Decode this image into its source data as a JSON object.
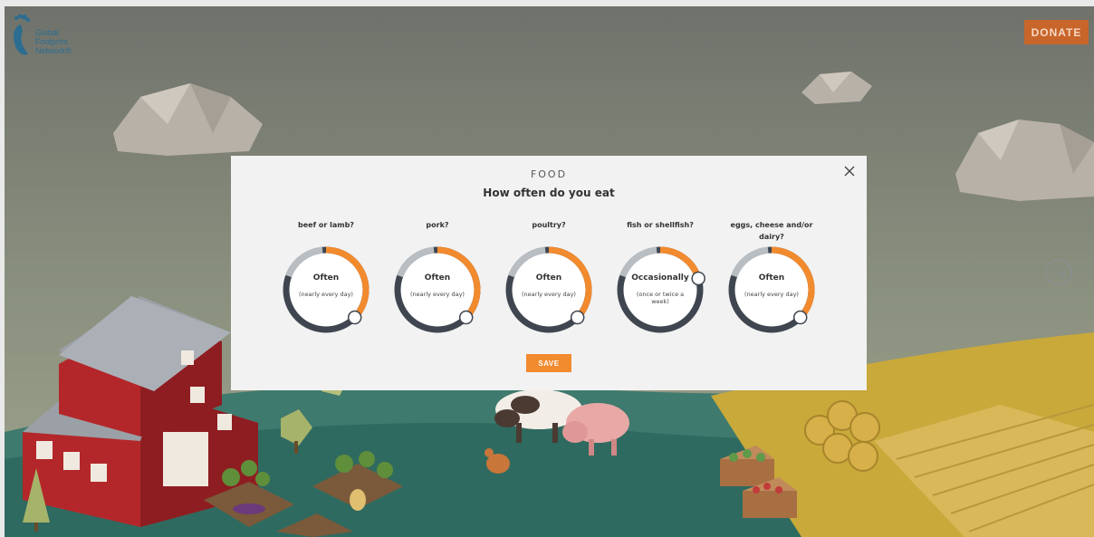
{
  "brand": {
    "logo_text": "Global\nFootprint\nNetwork®",
    "donate_label": "DONATE"
  },
  "modal": {
    "category": "FOOD",
    "question": "How often do you eat",
    "save_label": "SAVE",
    "items": [
      {
        "label": "beef or lamb?",
        "value": "Often",
        "detail": "(nearly every day)",
        "level": 0.9
      },
      {
        "label": "pork?",
        "value": "Often",
        "detail": "(nearly every day)",
        "level": 0.9
      },
      {
        "label": "poultry?",
        "value": "Often",
        "detail": "(nearly every day)",
        "level": 0.9
      },
      {
        "label": "fish or shellfish?",
        "value": "Occasionally",
        "detail": "(once or twice a week)",
        "level": 0.3
      },
      {
        "label": "eggs, cheese and/or dairy?",
        "value": "Often",
        "detail": "(nearly every day)",
        "level": 0.9
      }
    ]
  },
  "colors": {
    "accent": "#f28a2e",
    "donate": "#c8652a",
    "ring_dark": "#3f4650",
    "ring_light": "#b9bec3"
  }
}
